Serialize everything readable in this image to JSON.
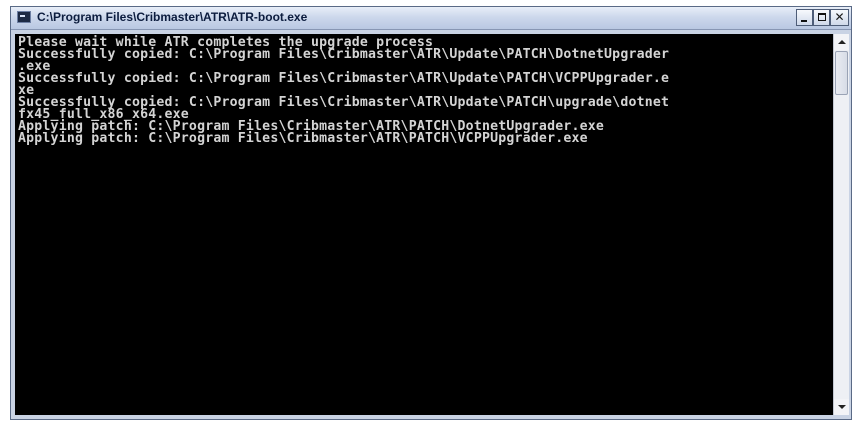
{
  "window": {
    "title": "C:\\Program Files\\Cribmaster\\ATR\\ATR-boot.exe",
    "icon": "console-icon",
    "controls": {
      "minimize_icon": "minimize-icon",
      "maximize_icon": "maximize-icon",
      "close_glyph": "✕"
    }
  },
  "console": {
    "background": "#000000",
    "text_color": "#d4d4d4",
    "lines": [
      "Please wait while ATR completes the upgrade process",
      "Successfully copied: C:\\Program Files\\Cribmaster\\ATR\\Update\\PATCH\\DotnetUpgrader",
      ".exe",
      "Successfully copied: C:\\Program Files\\Cribmaster\\ATR\\Update\\PATCH\\VCPPUpgrader.e",
      "xe",
      "Successfully copied: C:\\Program Files\\Cribmaster\\ATR\\Update\\PATCH\\upgrade\\dotnet",
      "fx45_full_x86_x64.exe",
      "Applying patch: C:\\Program Files\\Cribmaster\\ATR\\PATCH\\DotnetUpgrader.exe",
      "Applying patch: C:\\Program Files\\Cribmaster\\ATR\\PATCH\\VCPPUpgrader.exe"
    ]
  },
  "scrollbar": {
    "up_icon": "scroll-up-arrow-icon",
    "down_icon": "scroll-down-arrow-icon"
  }
}
